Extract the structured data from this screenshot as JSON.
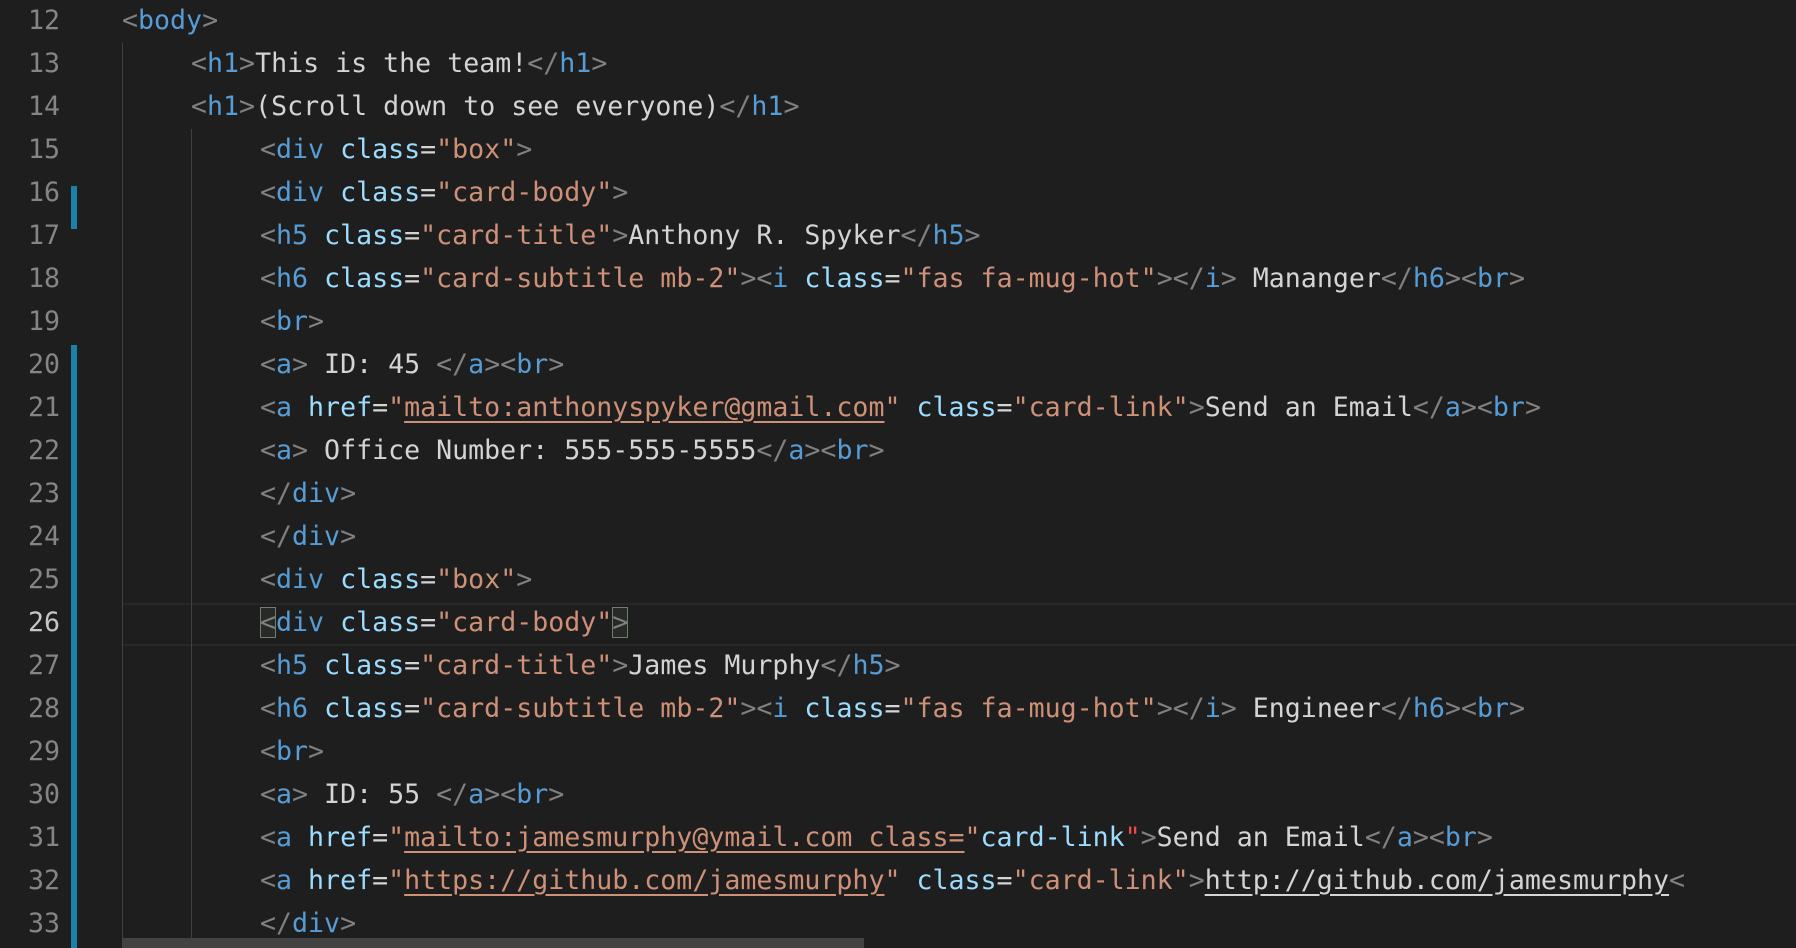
{
  "editor": {
    "active_line": "26",
    "line_numbers": [
      "12",
      "13",
      "14",
      "15",
      "16",
      "17",
      "18",
      "19",
      "20",
      "21",
      "22",
      "23",
      "24",
      "25",
      "26",
      "27",
      "28",
      "29",
      "30",
      "31",
      "32",
      "33"
    ],
    "lines": [
      {
        "ln": "12",
        "indent": 0,
        "tokens": [
          [
            "punc",
            "<"
          ],
          [
            "tag",
            "body"
          ],
          [
            "punc",
            ">"
          ]
        ]
      },
      {
        "ln": "13",
        "indent": 1,
        "tokens": [
          [
            "punc",
            "<"
          ],
          [
            "tag",
            "h1"
          ],
          [
            "punc",
            ">"
          ],
          [
            "txt",
            "This is the team!"
          ],
          [
            "punc",
            "</"
          ],
          [
            "tag",
            "h1"
          ],
          [
            "punc",
            ">"
          ]
        ]
      },
      {
        "ln": "14",
        "indent": 1,
        "tokens": [
          [
            "punc",
            "<"
          ],
          [
            "tag",
            "h1"
          ],
          [
            "punc",
            ">"
          ],
          [
            "txt",
            "(Scroll down to see everyone)"
          ],
          [
            "punc",
            "</"
          ],
          [
            "tag",
            "h1"
          ],
          [
            "punc",
            ">"
          ]
        ]
      },
      {
        "ln": "15",
        "indent": 2,
        "tokens": [
          [
            "punc",
            "<"
          ],
          [
            "tag",
            "div"
          ],
          [
            "txt",
            " "
          ],
          [
            "attr",
            "class"
          ],
          [
            "txt",
            "="
          ],
          [
            "str",
            "\"box\""
          ],
          [
            "punc",
            ">"
          ]
        ]
      },
      {
        "ln": "16",
        "indent": 2,
        "tokens": [
          [
            "punc",
            "<"
          ],
          [
            "tag",
            "div"
          ],
          [
            "txt",
            " "
          ],
          [
            "attr",
            "class"
          ],
          [
            "txt",
            "="
          ],
          [
            "str",
            "\"card-body\""
          ],
          [
            "punc",
            ">"
          ]
        ]
      },
      {
        "ln": "17",
        "indent": 2,
        "tokens": [
          [
            "punc",
            "<"
          ],
          [
            "tag",
            "h5"
          ],
          [
            "txt",
            " "
          ],
          [
            "attr",
            "class"
          ],
          [
            "txt",
            "="
          ],
          [
            "str",
            "\"card-title\""
          ],
          [
            "punc",
            ">"
          ],
          [
            "txt",
            "Anthony R. Spyker"
          ],
          [
            "punc",
            "</"
          ],
          [
            "tag",
            "h5"
          ],
          [
            "punc",
            ">"
          ]
        ]
      },
      {
        "ln": "18",
        "indent": 2,
        "tokens": [
          [
            "punc",
            "<"
          ],
          [
            "tag",
            "h6"
          ],
          [
            "txt",
            " "
          ],
          [
            "attr",
            "class"
          ],
          [
            "txt",
            "="
          ],
          [
            "str",
            "\"card-subtitle mb-2\""
          ],
          [
            "punc",
            "><"
          ],
          [
            "tag",
            "i"
          ],
          [
            "txt",
            " "
          ],
          [
            "attr",
            "class"
          ],
          [
            "txt",
            "="
          ],
          [
            "str",
            "\"fas fa-mug-hot\""
          ],
          [
            "punc",
            "></"
          ],
          [
            "tag",
            "i"
          ],
          [
            "punc",
            ">"
          ],
          [
            "txt",
            " Mananger"
          ],
          [
            "punc",
            "</"
          ],
          [
            "tag",
            "h6"
          ],
          [
            "punc",
            "><"
          ],
          [
            "tag",
            "br"
          ],
          [
            "punc",
            ">"
          ]
        ]
      },
      {
        "ln": "19",
        "indent": 2,
        "tokens": [
          [
            "punc",
            "<"
          ],
          [
            "tag",
            "br"
          ],
          [
            "punc",
            ">"
          ]
        ]
      },
      {
        "ln": "20",
        "indent": 2,
        "tokens": [
          [
            "punc",
            "<"
          ],
          [
            "tag",
            "a"
          ],
          [
            "punc",
            ">"
          ],
          [
            "txt",
            " ID: 45 "
          ],
          [
            "punc",
            "</"
          ],
          [
            "tag",
            "a"
          ],
          [
            "punc",
            "><"
          ],
          [
            "tag",
            "br"
          ],
          [
            "punc",
            ">"
          ]
        ]
      },
      {
        "ln": "21",
        "indent": 2,
        "tokens": [
          [
            "punc",
            "<"
          ],
          [
            "tag",
            "a"
          ],
          [
            "txt",
            " "
          ],
          [
            "attr",
            "href"
          ],
          [
            "txt",
            "="
          ],
          [
            "str",
            "\""
          ],
          [
            "str link",
            "mailto:anthonyspyker@gmail.com"
          ],
          [
            "str",
            "\""
          ],
          [
            "txt",
            " "
          ],
          [
            "attr",
            "class"
          ],
          [
            "txt",
            "="
          ],
          [
            "str",
            "\"card-link\""
          ],
          [
            "punc",
            ">"
          ],
          [
            "txt",
            "Send an Email"
          ],
          [
            "punc",
            "</"
          ],
          [
            "tag",
            "a"
          ],
          [
            "punc",
            "><"
          ],
          [
            "tag",
            "br"
          ],
          [
            "punc",
            ">"
          ]
        ]
      },
      {
        "ln": "22",
        "indent": 2,
        "tokens": [
          [
            "punc",
            "<"
          ],
          [
            "tag",
            "a"
          ],
          [
            "punc",
            ">"
          ],
          [
            "txt",
            " Office Number: 555-555-5555"
          ],
          [
            "punc",
            "</"
          ],
          [
            "tag",
            "a"
          ],
          [
            "punc",
            "><"
          ],
          [
            "tag",
            "br"
          ],
          [
            "punc",
            ">"
          ]
        ]
      },
      {
        "ln": "23",
        "indent": 2,
        "tokens": [
          [
            "punc",
            "</"
          ],
          [
            "tag",
            "div"
          ],
          [
            "punc",
            ">"
          ]
        ]
      },
      {
        "ln": "24",
        "indent": 2,
        "tokens": [
          [
            "punc",
            "</"
          ],
          [
            "tag",
            "div"
          ],
          [
            "punc",
            ">"
          ]
        ]
      },
      {
        "ln": "25",
        "indent": 2,
        "tokens": [
          [
            "punc",
            "<"
          ],
          [
            "tag",
            "div"
          ],
          [
            "txt",
            " "
          ],
          [
            "attr",
            "class"
          ],
          [
            "txt",
            "="
          ],
          [
            "str",
            "\"box\""
          ],
          [
            "punc",
            ">"
          ]
        ]
      },
      {
        "ln": "26",
        "indent": 2,
        "tokens": [
          [
            "punc bracket",
            "<"
          ],
          [
            "tag",
            "div"
          ],
          [
            "txt",
            " "
          ],
          [
            "attr",
            "class"
          ],
          [
            "txt",
            "="
          ],
          [
            "str",
            "\"card-body\""
          ],
          [
            "punc bracket",
            ">"
          ]
        ]
      },
      {
        "ln": "27",
        "indent": 2,
        "tokens": [
          [
            "punc",
            "<"
          ],
          [
            "tag",
            "h5"
          ],
          [
            "txt",
            " "
          ],
          [
            "attr",
            "class"
          ],
          [
            "txt",
            "="
          ],
          [
            "str",
            "\"card-title\""
          ],
          [
            "punc",
            ">"
          ],
          [
            "txt",
            "James Murphy"
          ],
          [
            "punc",
            "</"
          ],
          [
            "tag",
            "h5"
          ],
          [
            "punc",
            ">"
          ]
        ]
      },
      {
        "ln": "28",
        "indent": 2,
        "tokens": [
          [
            "punc",
            "<"
          ],
          [
            "tag",
            "h6"
          ],
          [
            "txt",
            " "
          ],
          [
            "attr",
            "class"
          ],
          [
            "txt",
            "="
          ],
          [
            "str",
            "\"card-subtitle mb-2\""
          ],
          [
            "punc",
            "><"
          ],
          [
            "tag",
            "i"
          ],
          [
            "txt",
            " "
          ],
          [
            "attr",
            "class"
          ],
          [
            "txt",
            "="
          ],
          [
            "str",
            "\"fas fa-mug-hot\""
          ],
          [
            "punc",
            "></"
          ],
          [
            "tag",
            "i"
          ],
          [
            "punc",
            ">"
          ],
          [
            "txt",
            " Engineer"
          ],
          [
            "punc",
            "</"
          ],
          [
            "tag",
            "h6"
          ],
          [
            "punc",
            "><"
          ],
          [
            "tag",
            "br"
          ],
          [
            "punc",
            ">"
          ]
        ]
      },
      {
        "ln": "29",
        "indent": 2,
        "tokens": [
          [
            "punc",
            "<"
          ],
          [
            "tag",
            "br"
          ],
          [
            "punc",
            ">"
          ]
        ]
      },
      {
        "ln": "30",
        "indent": 2,
        "tokens": [
          [
            "punc",
            "<"
          ],
          [
            "tag",
            "a"
          ],
          [
            "punc",
            ">"
          ],
          [
            "txt",
            " ID: 55 "
          ],
          [
            "punc",
            "</"
          ],
          [
            "tag",
            "a"
          ],
          [
            "punc",
            "><"
          ],
          [
            "tag",
            "br"
          ],
          [
            "punc",
            ">"
          ]
        ]
      },
      {
        "ln": "31",
        "indent": 2,
        "tokens": [
          [
            "punc",
            "<"
          ],
          [
            "tag",
            "a"
          ],
          [
            "txt",
            " "
          ],
          [
            "attr",
            "href"
          ],
          [
            "txt",
            "="
          ],
          [
            "str",
            "\""
          ],
          [
            "str link",
            "mailto:jamesmurphy@ymail.com class="
          ],
          [
            "str",
            "\""
          ],
          [
            "attr",
            "card-link"
          ],
          [
            "err",
            "\""
          ],
          [
            "punc",
            ">"
          ],
          [
            "txt",
            "Send an Email"
          ],
          [
            "punc",
            "</"
          ],
          [
            "tag",
            "a"
          ],
          [
            "punc",
            "><"
          ],
          [
            "tag",
            "br"
          ],
          [
            "punc",
            ">"
          ]
        ]
      },
      {
        "ln": "32",
        "indent": 2,
        "tokens": [
          [
            "punc",
            "<"
          ],
          [
            "tag",
            "a"
          ],
          [
            "txt",
            " "
          ],
          [
            "attr",
            "href"
          ],
          [
            "txt",
            "="
          ],
          [
            "str",
            "\""
          ],
          [
            "str link",
            "https://github.com/jamesmurphy"
          ],
          [
            "str",
            "\""
          ],
          [
            "txt",
            " "
          ],
          [
            "attr",
            "class"
          ],
          [
            "txt",
            "="
          ],
          [
            "str",
            "\"card-link\""
          ],
          [
            "punc",
            ">"
          ],
          [
            "txt link",
            "http://github.com/jamesmurphy"
          ],
          [
            "punc",
            "<"
          ]
        ]
      },
      {
        "ln": "33",
        "indent": 2,
        "tokens": [
          [
            "punc",
            "</"
          ],
          [
            "tag",
            "div"
          ],
          [
            "punc",
            ">"
          ]
        ]
      }
    ]
  },
  "colors": {
    "background": "#1e1e1e",
    "tag": "#569cd6",
    "attribute": "#9cdcfe",
    "string": "#ce9178",
    "punctuation": "#808080",
    "text": "#d4d4d4",
    "line_number": "#858585",
    "change_marker": "#1b81a8"
  }
}
